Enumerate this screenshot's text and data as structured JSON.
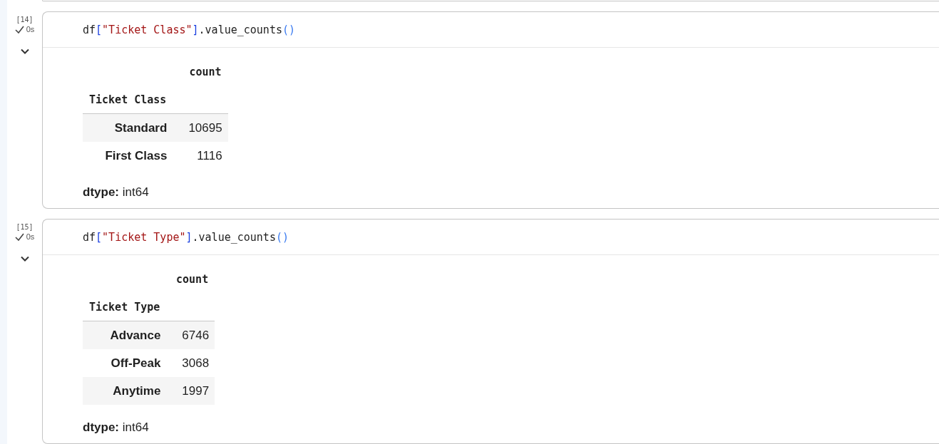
{
  "cells": [
    {
      "execution_count": "[14]",
      "status": "0s",
      "expanded": true,
      "code": [
        {
          "kind": "plain",
          "text": "df"
        },
        {
          "kind": "bracket",
          "text": "["
        },
        {
          "kind": "string",
          "text": "\"Ticket Class\""
        },
        {
          "kind": "bracket",
          "text": "]"
        },
        {
          "kind": "plain",
          "text": ".value_counts"
        },
        {
          "kind": "paren",
          "text": "()"
        }
      ],
      "output": {
        "column": "count",
        "index_name": "Ticket Class",
        "rows": [
          {
            "label": "Standard",
            "value": "10695"
          },
          {
            "label": "First Class",
            "value": "1116"
          }
        ],
        "dtype": "**dtype:** int64"
      }
    },
    {
      "execution_count": "[15]",
      "status": "0s",
      "expanded": true,
      "code": [
        {
          "kind": "plain",
          "text": "df"
        },
        {
          "kind": "bracket",
          "text": "["
        },
        {
          "kind": "string",
          "text": "\"Ticket Type\""
        },
        {
          "kind": "bracket",
          "text": "]"
        },
        {
          "kind": "plain",
          "text": ".value_counts"
        },
        {
          "kind": "paren",
          "text": "()"
        }
      ],
      "output": {
        "column": "count",
        "index_name": "Ticket Type",
        "rows": [
          {
            "label": "Advance",
            "value": "6746"
          },
          {
            "label": "Off-Peak",
            "value": "3068"
          },
          {
            "label": "Anytime",
            "value": "1997"
          }
        ],
        "dtype": "**dtype:** int64"
      }
    }
  ]
}
